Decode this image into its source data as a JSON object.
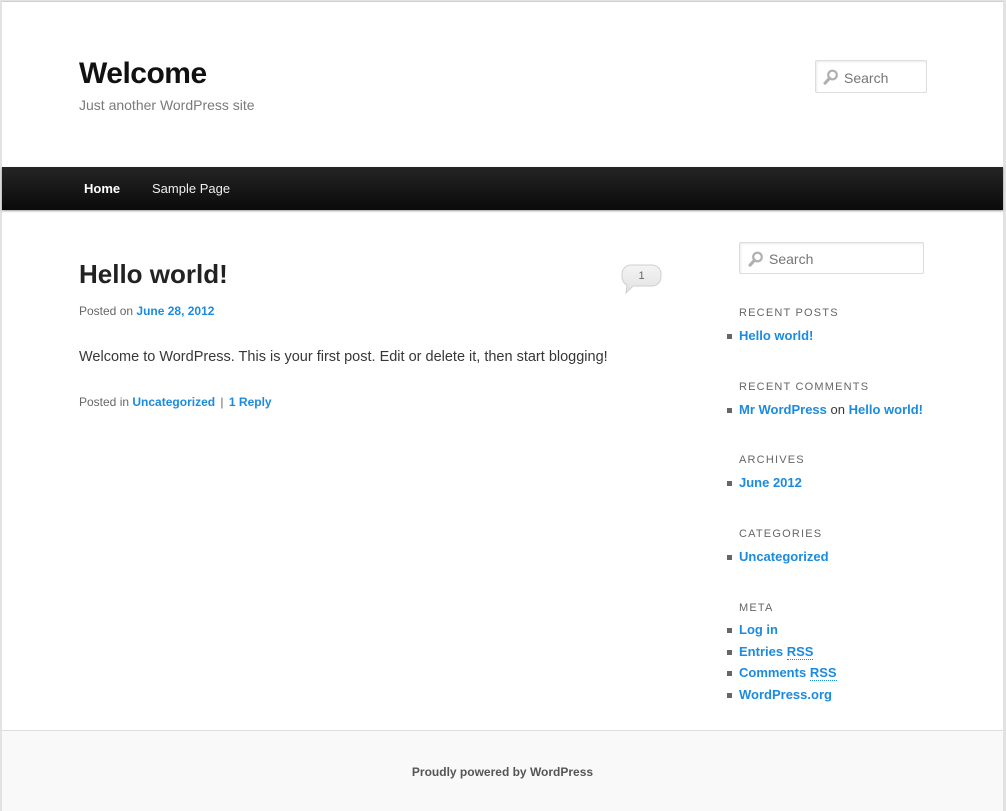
{
  "site": {
    "title": "Welcome",
    "description": "Just another WordPress site"
  },
  "header_search": {
    "placeholder": "Search",
    "icon": "magnifier-icon"
  },
  "nav": {
    "items": [
      {
        "label": "Home",
        "current": true
      },
      {
        "label": "Sample Page",
        "current": false
      }
    ]
  },
  "post": {
    "title": "Hello world!",
    "posted_on_label": "Posted on",
    "date": "June 28, 2012",
    "comment_count": "1",
    "content": "Welcome to WordPress. This is your first post. Edit or delete it, then start blogging!",
    "posted_in_label": "Posted in",
    "category": "Uncategorized",
    "separator": "|",
    "reply_link": "1 Reply"
  },
  "sidebar": {
    "search": {
      "placeholder": "Search",
      "icon": "magnifier-icon"
    },
    "recent_posts": {
      "title": "RECENT POSTS",
      "items": [
        "Hello world!"
      ]
    },
    "recent_comments": {
      "title": "RECENT COMMENTS",
      "author": "Mr WordPress",
      "on": "on",
      "post": "Hello world!"
    },
    "archives": {
      "title": "ARCHIVES",
      "items": [
        "June 2012"
      ]
    },
    "categories": {
      "title": "CATEGORIES",
      "items": [
        "Uncategorized"
      ]
    },
    "meta": {
      "title": "META",
      "login": "Log in",
      "entries": "Entries",
      "comments": "Comments",
      "rss": "RSS",
      "wordpress_org": "WordPress.org"
    }
  },
  "footer": {
    "credit": "Proudly powered by WordPress"
  },
  "colors": {
    "link": "#1b8be0",
    "nav_bg": "#1a1a1a",
    "text": "#373737",
    "footer_bg": "#f9f9f9"
  }
}
